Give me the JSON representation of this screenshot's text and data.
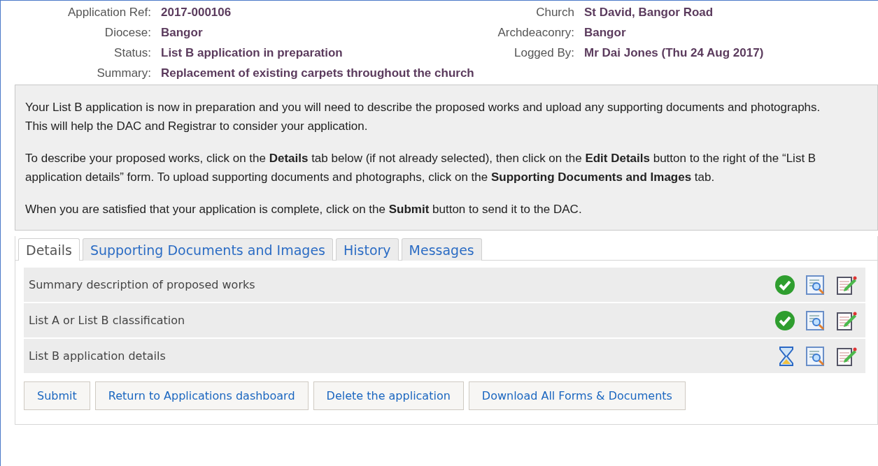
{
  "header": {
    "left": [
      {
        "label": "Application Ref:",
        "value": "2017-000106"
      },
      {
        "label": "Diocese:",
        "value": "Bangor"
      },
      {
        "label": "Status:",
        "value": "List B application in preparation"
      },
      {
        "label": "Summary:",
        "value": "Replacement of existing carpets throughout the church"
      }
    ],
    "right": [
      {
        "label": "Church",
        "value": "St David, Bangor Road"
      },
      {
        "label": "Archdeaconry:",
        "value": "Bangor"
      },
      {
        "label": "Logged By:",
        "value": "Mr Dai Jones (Thu 24 Aug 2017)"
      }
    ]
  },
  "info": [
    "Your List B application is now in preparation and you will need to describe the proposed works and upload any supporting documents and photographs. This will help the DAC and Registrar to consider your application.",
    "To describe your proposed works, click on the **Details** tab below (if not already selected), then click on the **Edit Details** button to the right of the “List B application details” form. To upload supporting documents and photographs, click on the **Supporting Documents and Images** tab.",
    "When you are satisfied that your application is complete, click on the **Submit** button to send it to the DAC."
  ],
  "tabs": [
    {
      "label": "Details",
      "selected": true
    },
    {
      "label": "Supporting Documents and Images",
      "selected": false
    },
    {
      "label": "History",
      "selected": false
    },
    {
      "label": "Messages",
      "selected": false
    }
  ],
  "forms": [
    {
      "name": "Summary description of proposed works",
      "kind": "complete"
    },
    {
      "name": "List A or List B classification",
      "kind": "complete"
    },
    {
      "name": "List B application details",
      "kind": "pending"
    }
  ],
  "buttons": [
    "Submit",
    "Return to Applications dashboard",
    "Delete the application",
    "Download All Forms & Documents"
  ]
}
